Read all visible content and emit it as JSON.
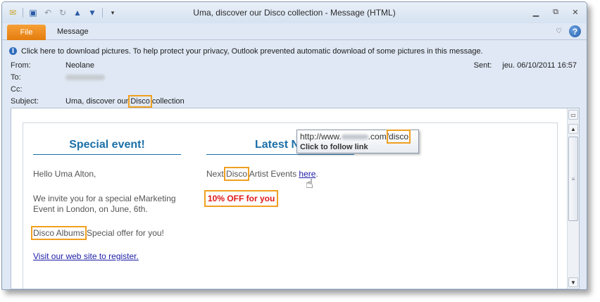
{
  "window": {
    "title": "Uma, discover our Disco collection  -  Message (HTML)"
  },
  "ribbon": {
    "file_tab": "File",
    "message_tab": "Message"
  },
  "infobar": {
    "text": "Click here to download pictures. To help protect your privacy, Outlook prevented automatic download of some pictures in this message."
  },
  "headers": {
    "from_label": "From:",
    "from_value": "Neolane",
    "to_label": "To:",
    "cc_label": "Cc:",
    "subject_label": "Subject:",
    "subject_before": "Uma, discover our",
    "subject_highlight": "Disco",
    "subject_after": "collection",
    "sent_label": "Sent:",
    "sent_value": "jeu. 06/10/2011 16:57"
  },
  "email": {
    "left": {
      "title": "Special event!",
      "greeting": "Hello Uma Alton,",
      "invite": "We invite you for a special eMarketing Event in London, on June, 6th.",
      "albums_highlight": "Disco Albums",
      "albums_after": "Special offer for you!",
      "register_link": "Visit our web site to register."
    },
    "right": {
      "title": "Latest Ne",
      "events_before": "Next",
      "events_highlight": "Disco",
      "events_after": "Artist Events",
      "here_link": "here",
      "here_after": ".",
      "offer": "10% OFF for you"
    }
  },
  "tooltip": {
    "url_prefix": "http://www.",
    "url_middle": ".com/",
    "url_highlight": "disco",
    "action": "Click to follow link"
  },
  "colors": {
    "heading_blue": "#1b6fa8",
    "highlight_orange": "#f0a020",
    "offer_red": "#e01818",
    "file_tab_orange": "#e47c0e"
  }
}
